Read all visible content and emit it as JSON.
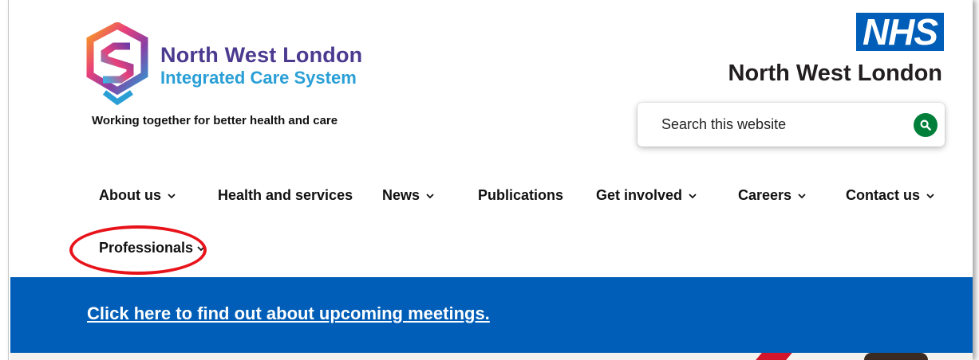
{
  "ics": {
    "name_line1": "North West London",
    "name_line2": "Integrated Care System",
    "tagline": "Working together for better health and care",
    "logo_icon": "ics-hexagon-s-logo"
  },
  "nhs": {
    "badge": "NHS",
    "region": "North West London",
    "brand_color": "#005eb8"
  },
  "search": {
    "placeholder": "Search this website",
    "value": "",
    "button_icon": "search-icon",
    "button_color": "#007f3b"
  },
  "nav": {
    "about": "About us",
    "health": "Health and services",
    "news": "News",
    "publications": "Publications",
    "get_involved": "Get involved",
    "careers": "Careers",
    "contact": "Contact us",
    "professionals": "Professionals",
    "dropdown_icon": "chevron-down-icon"
  },
  "banner": {
    "link_text": "Click here to find out about upcoming meetings.",
    "background": "#005eb8"
  },
  "annotation": {
    "color": "#e8121a",
    "target": "Professionals"
  }
}
